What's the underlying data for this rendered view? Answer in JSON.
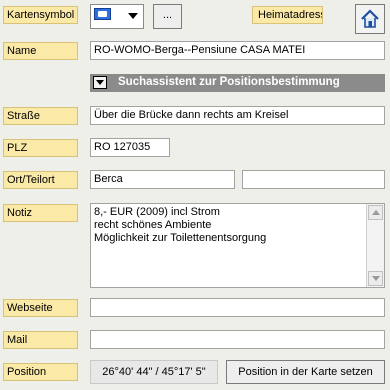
{
  "labels": {
    "kartensymbol": "Kartensymbol",
    "heimatadresse": "Heimatadresse",
    "name": "Name",
    "strasse": "Straße",
    "plz": "PLZ",
    "ort": "Ort/Teilort",
    "notiz": "Notiz",
    "webseite": "Webseite",
    "mail": "Mail",
    "position": "Position"
  },
  "buttons": {
    "browse": "...",
    "assistant": "Suchassistent zur Positionsbestimmung",
    "set_position": "Position in der Karte setzen"
  },
  "fields": {
    "name": "RO-WOMO-Berga--Pensiune CASA MATEI",
    "strasse": "Über die Brücke  dann rechts am Kreisel",
    "plz": "RO 127035",
    "ort": "Berca",
    "teilort": "",
    "notiz": "8,- EUR (2009) incl Strom\nrecht schönes Ambiente\nMöglichkeit zur Toilettenentsorgung",
    "webseite": "",
    "mail": ""
  },
  "position": {
    "coords": "26°40' 44\" / 45°17' 5\""
  },
  "icons": {
    "kartensymbol": "camper-van-icon",
    "dropdown": "chevron-down-icon",
    "home": "home-icon"
  },
  "colors": {
    "label_bg": "#fbe9a7",
    "assistant_bar": "#8b8b8b",
    "window_bg": "#efefe9"
  }
}
